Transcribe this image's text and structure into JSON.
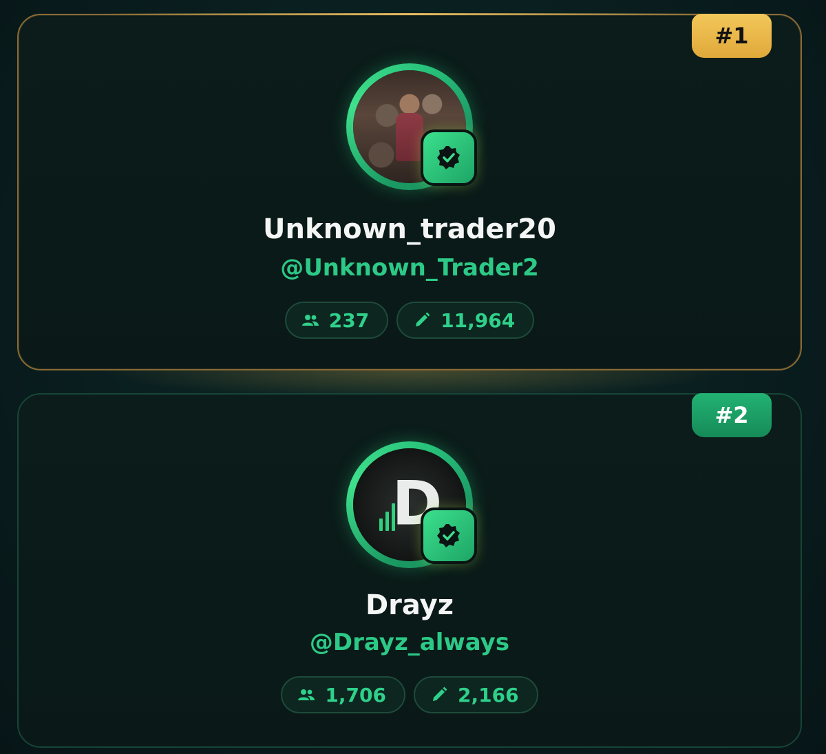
{
  "leaderboard": [
    {
      "rank": "#1",
      "name": "Unknown_trader20",
      "handle": "@Unknown_Trader2",
      "followers": "237",
      "posts": "11,964",
      "accent": "#e0a93a",
      "avatar": "photo",
      "verified_icon": "verified-check-icon"
    },
    {
      "rank": "#2",
      "name": "Drayz",
      "handle": "@Drayz_always",
      "followers": "1,706",
      "posts": "2,166",
      "accent": "#168b58",
      "avatar": "logo",
      "verified_icon": "verified-check-icon"
    }
  ],
  "icons": {
    "followers": "people-icon",
    "posts": "pencil-icon"
  },
  "colors": {
    "handle": "#2cc987",
    "gold": "#e0a93a",
    "green": "#1ea566"
  }
}
